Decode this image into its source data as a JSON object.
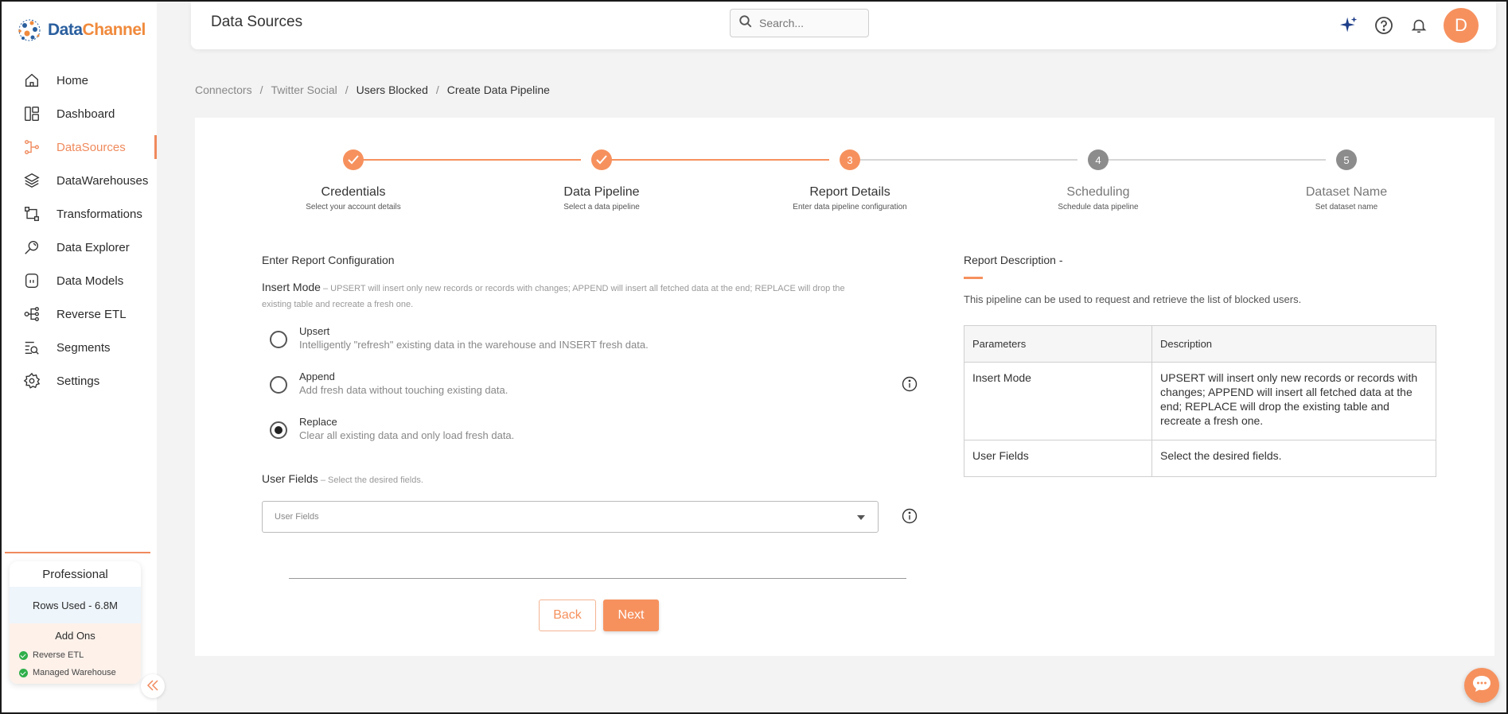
{
  "app": {
    "logo_part1": "Data",
    "logo_part2": "Channel"
  },
  "sidebar": {
    "items": [
      {
        "label": "Home",
        "icon": "home-icon"
      },
      {
        "label": "Dashboard",
        "icon": "dashboard-icon"
      },
      {
        "label": "DataSources",
        "icon": "datasources-icon",
        "active": true
      },
      {
        "label": "DataWarehouses",
        "icon": "datawarehouses-icon"
      },
      {
        "label": "Transformations",
        "icon": "transformations-icon"
      },
      {
        "label": "Data Explorer",
        "icon": "data-explorer-icon"
      },
      {
        "label": "Data Models",
        "icon": "data-models-icon"
      },
      {
        "label": "Reverse ETL",
        "icon": "reverse-etl-icon"
      },
      {
        "label": "Segments",
        "icon": "segments-icon"
      },
      {
        "label": "Settings",
        "icon": "settings-icon"
      }
    ],
    "plan": {
      "title": "Professional",
      "rows_used": "Rows Used - 6.8M",
      "addons_title": "Add Ons",
      "addons": [
        "Reverse ETL",
        "Managed Warehouse"
      ]
    }
  },
  "header": {
    "title": "Data Sources",
    "search_placeholder": "Search...",
    "avatar_letter": "D"
  },
  "breadcrumb": [
    "Connectors",
    "Twitter Social",
    "Users Blocked",
    "Create Data Pipeline"
  ],
  "stepper": [
    {
      "number": "1",
      "label": "Credentials",
      "sub": "Select your account details",
      "state": "done"
    },
    {
      "number": "2",
      "label": "Data Pipeline",
      "sub": "Select a data pipeline",
      "state": "done"
    },
    {
      "number": "3",
      "label": "Report Details",
      "sub": "Enter data pipeline configuration",
      "state": "current"
    },
    {
      "number": "4",
      "label": "Scheduling",
      "sub": "Schedule data pipeline",
      "state": "todo"
    },
    {
      "number": "5",
      "label": "Dataset Name",
      "sub": "Set dataset name",
      "state": "todo"
    }
  ],
  "form": {
    "section_title": "Enter Report Configuration",
    "insert_mode_label": "Insert Mode",
    "insert_mode_help": " – UPSERT will insert only new records or records with changes; APPEND will insert all fetched data at the end; REPLACE will drop the existing table and recreate a fresh one.",
    "options": [
      {
        "title": "Upsert",
        "desc": "Intelligently \"refresh\" existing data in the warehouse and INSERT fresh data.",
        "selected": false
      },
      {
        "title": "Append",
        "desc": "Add fresh data without touching existing data.",
        "selected": false
      },
      {
        "title": "Replace",
        "desc": "Clear all existing data and only load fresh data.",
        "selected": true
      }
    ],
    "user_fields_label": "User Fields",
    "user_fields_help": " – Select the desired fields.",
    "user_fields_placeholder": "User Fields",
    "back_label": "Back",
    "next_label": "Next"
  },
  "report_description": {
    "title": "Report Description -",
    "text": "This pipeline can be used to request and retrieve the list of blocked users.",
    "table_headers": [
      "Parameters",
      "Description"
    ],
    "rows": [
      [
        "Insert Mode",
        "UPSERT will insert only new records or records with changes; APPEND will insert all fetched data at the end; REPLACE will drop the existing table and recreate a fresh one."
      ],
      [
        "User Fields",
        "Select the desired fields."
      ]
    ]
  },
  "colors": {
    "accent": "#f6915e",
    "brand_blue": "#2a5f9e",
    "step_todo": "#8c8c8c"
  }
}
